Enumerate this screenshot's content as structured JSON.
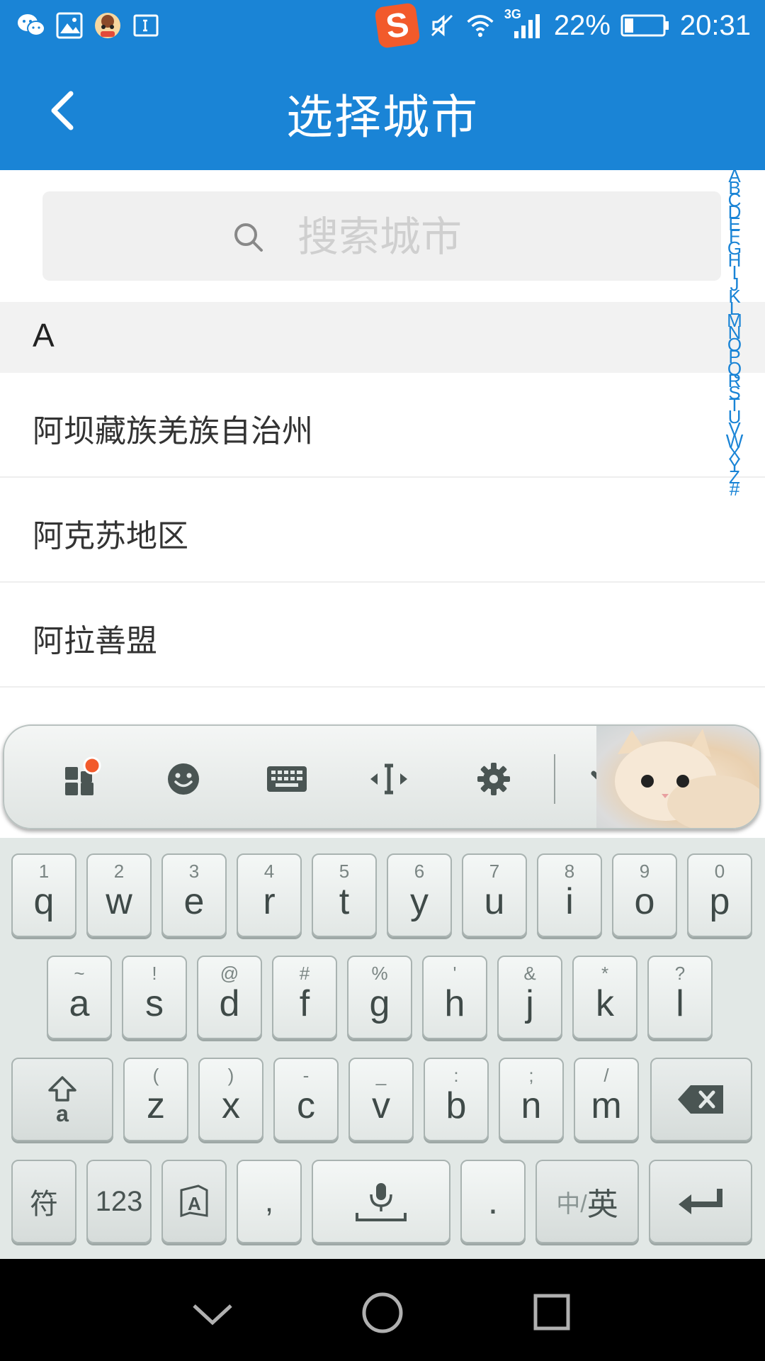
{
  "status_bar": {
    "battery": "22%",
    "time": "20:31",
    "network": "3G",
    "sogou_letter": "S"
  },
  "app_bar": {
    "title": "选择城市"
  },
  "search": {
    "placeholder": "搜索城市"
  },
  "city_list": {
    "section_header": "A",
    "items": [
      "阿坝藏族羌族自治州",
      "阿克苏地区",
      "阿拉善盟"
    ]
  },
  "index_bar": {
    "letters": [
      "A",
      "B",
      "C",
      "D",
      "E",
      "F",
      "G",
      "H",
      "I",
      "J",
      "K",
      "L",
      "M",
      "N",
      "O",
      "P",
      "Q",
      "R",
      "S",
      "T",
      "U",
      "V",
      "W",
      "X",
      "Y",
      "Z",
      "#"
    ]
  },
  "keyboard": {
    "row1": [
      {
        "key": "q",
        "hint": "1"
      },
      {
        "key": "w",
        "hint": "2"
      },
      {
        "key": "e",
        "hint": "3"
      },
      {
        "key": "r",
        "hint": "4"
      },
      {
        "key": "t",
        "hint": "5"
      },
      {
        "key": "y",
        "hint": "6"
      },
      {
        "key": "u",
        "hint": "7"
      },
      {
        "key": "i",
        "hint": "8"
      },
      {
        "key": "o",
        "hint": "9"
      },
      {
        "key": "p",
        "hint": "0"
      }
    ],
    "row2": [
      {
        "key": "a",
        "hint": "~"
      },
      {
        "key": "s",
        "hint": "!"
      },
      {
        "key": "d",
        "hint": "@"
      },
      {
        "key": "f",
        "hint": "#"
      },
      {
        "key": "g",
        "hint": "%"
      },
      {
        "key": "h",
        "hint": "'"
      },
      {
        "key": "j",
        "hint": "&"
      },
      {
        "key": "k",
        "hint": "*"
      },
      {
        "key": "l",
        "hint": "?"
      }
    ],
    "row3": [
      {
        "key": "z",
        "hint": "("
      },
      {
        "key": "x",
        "hint": ")"
      },
      {
        "key": "c",
        "hint": "-"
      },
      {
        "key": "v",
        "hint": "_"
      },
      {
        "key": "b",
        "hint": ":"
      },
      {
        "key": "n",
        "hint": ";"
      },
      {
        "key": "m",
        "hint": "/"
      }
    ],
    "shift_sub": "a",
    "symbol_label": "符",
    "numbers_label": "123",
    "comma_label": ",",
    "period_label": ".",
    "lang_zh": "中/",
    "lang_en": "英"
  },
  "colors": {
    "brand": "#1a84d6",
    "notification_dot": "#f25a2b"
  }
}
